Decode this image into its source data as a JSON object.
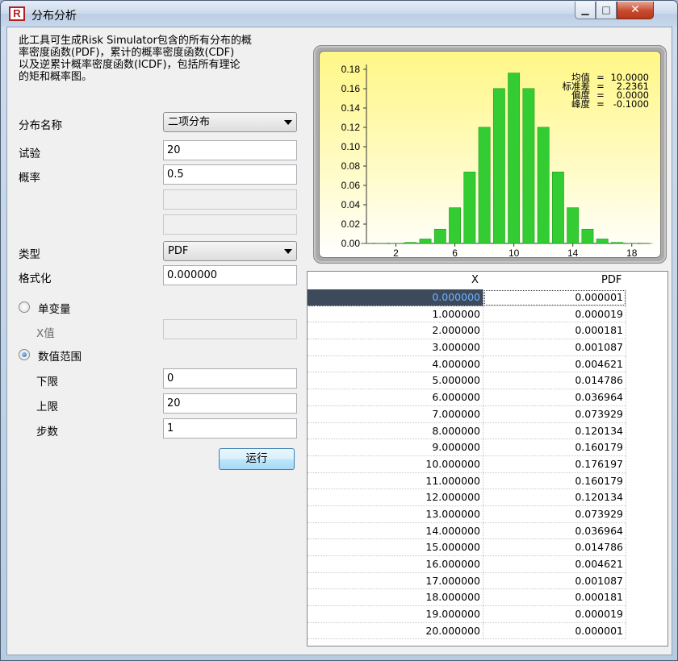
{
  "window": {
    "title": "分布分析",
    "app_icon_letter": "R",
    "buttons": {
      "minimize": "▁",
      "maximize": "□",
      "close": "✕"
    }
  },
  "description": "此工具可生成Risk Simulator包含的所有分布的概\n率密度函数(PDF)，累计的概率密度函数(CDF)\n以及逆累计概率密度函数(ICDF)，包括所有理论\n的矩和概率图。",
  "form": {
    "distribution_label": "分布名称",
    "distribution_value": "二项分布",
    "trials_label": "试验",
    "trials_value": "20",
    "probability_label": "概率",
    "probability_value": "0.5",
    "extra1_value": "",
    "extra2_value": "",
    "type_label": "类型",
    "type_value": "PDF",
    "format_label": "格式化",
    "format_value": "0.000000",
    "single_label": "单变量",
    "xvalue_label": "X值",
    "xvalue_value": "",
    "range_label": "数值范围",
    "lower_label": "下限",
    "lower_value": "0",
    "upper_label": "上限",
    "upper_value": "20",
    "step_label": "步数",
    "step_value": "1",
    "run_label": "运行"
  },
  "stats": [
    {
      "label": "均值",
      "value": "10.0000"
    },
    {
      "label": "标准差",
      "value": "2.2361"
    },
    {
      "label": "偏度",
      "value": "0.0000"
    },
    {
      "label": "峰度",
      "value": "-0.1000"
    }
  ],
  "colors": {
    "bar": "#33cc33",
    "bar_dark": "#1f9f1f",
    "selected_row": "#3d4a5c"
  },
  "chart_data": {
    "type": "bar",
    "x": [
      0,
      1,
      2,
      3,
      4,
      5,
      6,
      7,
      8,
      9,
      10,
      11,
      12,
      13,
      14,
      15,
      16,
      17,
      18,
      19,
      20
    ],
    "values": [
      1e-06,
      1.9e-05,
      0.000181,
      0.001087,
      0.004621,
      0.014786,
      0.036964,
      0.073929,
      0.120134,
      0.160179,
      0.176197,
      0.160179,
      0.120134,
      0.073929,
      0.036964,
      0.014786,
      0.004621,
      0.001087,
      0.000181,
      1.9e-05,
      1e-06
    ],
    "xticks": [
      "2",
      "6",
      "10",
      "14",
      "18"
    ],
    "yticks": [
      "0.00",
      "0.02",
      "0.04",
      "0.06",
      "0.08",
      "0.10",
      "0.12",
      "0.14",
      "0.16",
      "0.18"
    ],
    "xlim": [
      0,
      19
    ],
    "ylim": [
      0,
      0.18
    ],
    "grid": false
  },
  "table": {
    "headers": [
      "X",
      "PDF"
    ],
    "selected_index": 0,
    "rows": [
      {
        "x": "0.000000",
        "pdf": "0.000001"
      },
      {
        "x": "1.000000",
        "pdf": "0.000019"
      },
      {
        "x": "2.000000",
        "pdf": "0.000181"
      },
      {
        "x": "3.000000",
        "pdf": "0.001087"
      },
      {
        "x": "4.000000",
        "pdf": "0.004621"
      },
      {
        "x": "5.000000",
        "pdf": "0.014786"
      },
      {
        "x": "6.000000",
        "pdf": "0.036964"
      },
      {
        "x": "7.000000",
        "pdf": "0.073929"
      },
      {
        "x": "8.000000",
        "pdf": "0.120134"
      },
      {
        "x": "9.000000",
        "pdf": "0.160179"
      },
      {
        "x": "10.000000",
        "pdf": "0.176197"
      },
      {
        "x": "11.000000",
        "pdf": "0.160179"
      },
      {
        "x": "12.000000",
        "pdf": "0.120134"
      },
      {
        "x": "13.000000",
        "pdf": "0.073929"
      },
      {
        "x": "14.000000",
        "pdf": "0.036964"
      },
      {
        "x": "15.000000",
        "pdf": "0.014786"
      },
      {
        "x": "16.000000",
        "pdf": "0.004621"
      },
      {
        "x": "17.000000",
        "pdf": "0.001087"
      },
      {
        "x": "18.000000",
        "pdf": "0.000181"
      },
      {
        "x": "19.000000",
        "pdf": "0.000019"
      },
      {
        "x": "20.000000",
        "pdf": "0.000001"
      }
    ]
  }
}
